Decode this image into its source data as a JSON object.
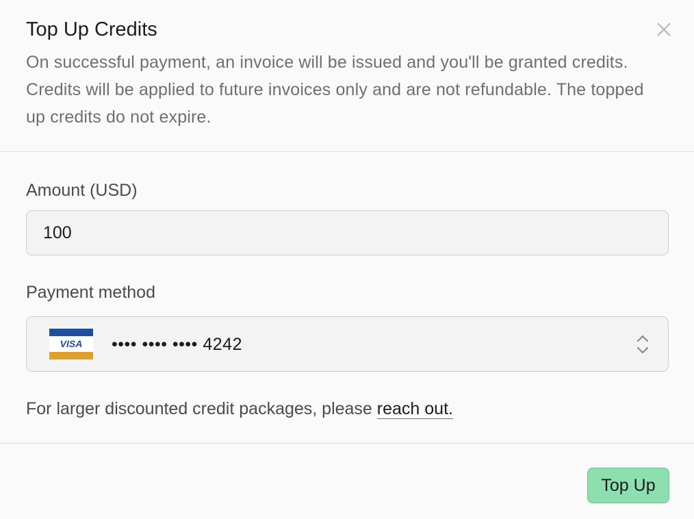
{
  "dialog": {
    "title": "Top Up Credits",
    "description": "On successful payment, an invoice will be issued and you'll be granted credits. Credits will be applied to future invoices only and are not refundable. The topped up credits do not expire.",
    "close_icon": "close-icon"
  },
  "amount": {
    "label": "Amount (USD)",
    "value": "100"
  },
  "payment": {
    "label": "Payment method",
    "card_brand": "VISA",
    "card_number": "•••• •••• •••• 4242",
    "chevron_icon": "chevron-up-down-icon"
  },
  "note": {
    "text": "For larger discounted credit packages, please ",
    "link_label": "reach out."
  },
  "footer": {
    "submit_label": "Top Up"
  },
  "colors": {
    "button_bg": "#8ddfb0",
    "button_border": "#5cc98c",
    "visa_blue": "#1f4f9c",
    "visa_gold": "#e0a02c"
  }
}
